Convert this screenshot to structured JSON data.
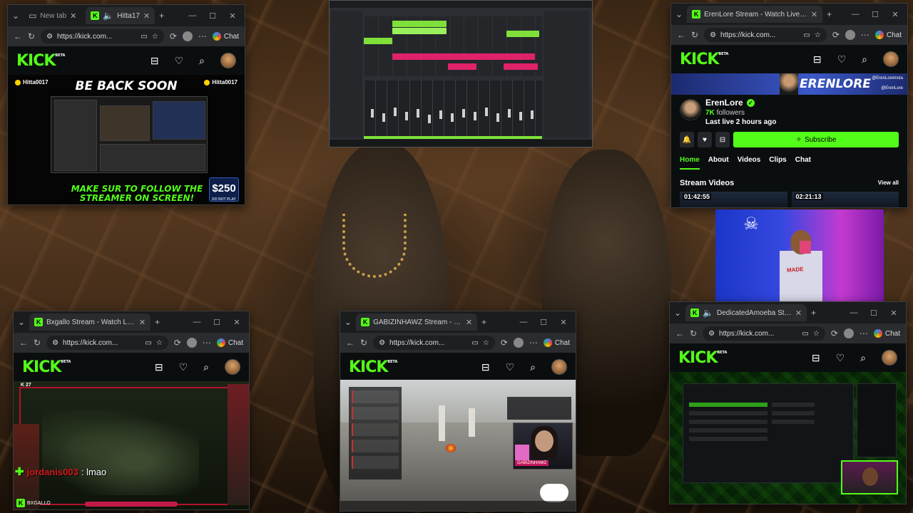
{
  "browser": {
    "url_text": "https://kick.com...",
    "chat_label": "Chat",
    "new_tab_label": "New tab"
  },
  "window_hitta": {
    "tab_title": "Hitta17",
    "stream": {
      "headline": "BE BACK SOON",
      "handle_left": "Hitta0017",
      "handle_right": "Hitta0017",
      "promo_text": "MAKE SUR TO FOLLOW THE STREAMER ON SCREEN!",
      "price": "$250",
      "price_sub": "DO NOT PLAY"
    }
  },
  "window_erenlore": {
    "tab_title": "ErenLore Stream - Watch Live on K",
    "banner_name": "ERENLORE",
    "banner_social_1": "@ErenLoreInsta",
    "banner_social_2": "@ErenLore",
    "channel": {
      "name": "ErenLore",
      "followers_count": "7K",
      "followers_label": "followers",
      "last_live": "Last live 2 hours ago",
      "subscribe_label": "Subscribe"
    },
    "tabs": [
      {
        "label": "Home"
      },
      {
        "label": "About"
      },
      {
        "label": "Videos"
      },
      {
        "label": "Clips"
      },
      {
        "label": "Chat"
      }
    ],
    "section_title": "Stream Videos",
    "view_all": "View all",
    "videos": [
      {
        "duration": "01:42:55"
      },
      {
        "duration": "02:21:13"
      }
    ]
  },
  "window_bxgallo": {
    "tab_title": "Bxgallo Stream - Watch Live o",
    "stream": {
      "viewer_count": "27",
      "chat_user": "jordanis003",
      "chat_message": ": lmao",
      "streamer_tag": "BXGALLO"
    }
  },
  "window_gabizin": {
    "tab_title": "GABIZINHAWZ Stream - Watc",
    "stream": {
      "tiktok_tag": "GABIZINHAWZ"
    }
  },
  "window_amoeba": {
    "tab_title": "DedicatedAmoeba Stream - W"
  },
  "webcam": {
    "shirt_text": "MADE"
  },
  "icons": {
    "kick_logo": "KICK",
    "logo_badge": "BETA"
  }
}
